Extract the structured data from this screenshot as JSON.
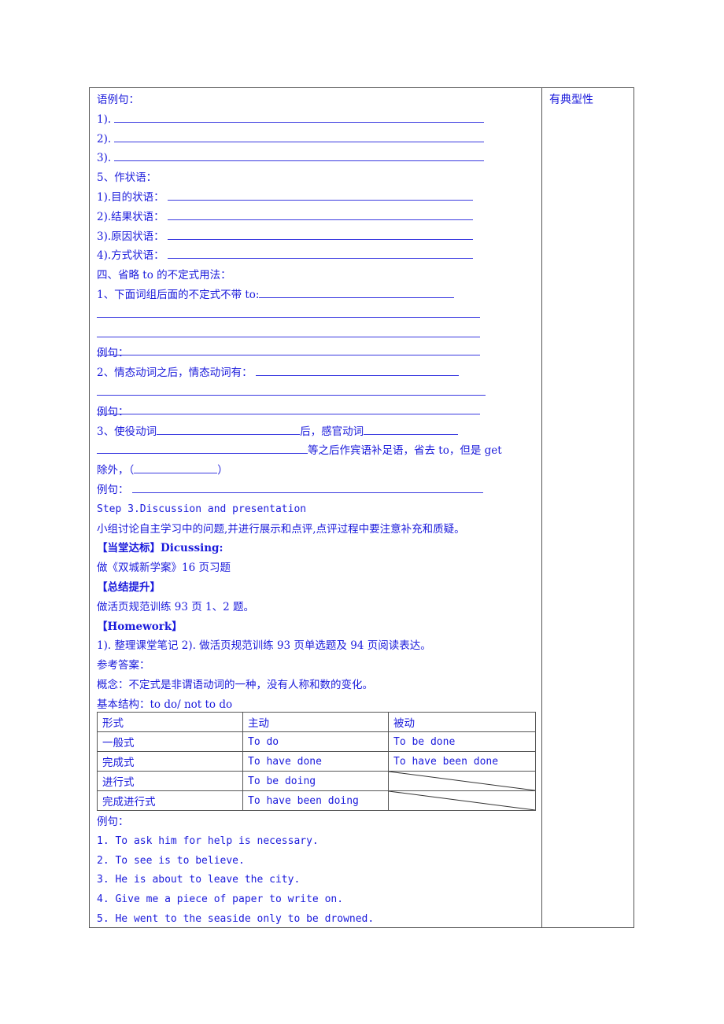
{
  "side_note": "有典型性",
  "lines": {
    "l0": "语例句：",
    "l1": "1).",
    "l2": "2).",
    "l3": "3).",
    "l4": "5、作状语：",
    "l5": "1).目的状语：",
    "l6": "2).结果状语：",
    "l7": "3).原因状语：",
    "l8": "4).方式状语：",
    "l9": "四、省略 to 的不定式用法：",
    "l10": "1、下面词组后面的不定式不带 to:",
    "l13": "例句：",
    "l14": "2、情态动词之后，情态动词有：",
    "l16": "例句：",
    "l17a": "3、使役动词",
    "l17b": "后，感官动词",
    "l18": "等之后作宾语补足语，省去 to，但是 get",
    "l19a": "除外，（",
    "l19b": "）",
    "l20": "例句：",
    "l21": "Step 3.Discussion and presentation",
    "l22": "小组讨论自主学习中的问题,并进行展示和点评,点评过程中要注意补充和质疑。",
    "l23": "【当堂达标】Dicussing:",
    "l24": "做《双城新学案》16 页习题",
    "l25": "【总结提升】",
    "l26": "做活页规范训练 93 页 1、2 题。",
    "l27": "【Homework】",
    "l28": "1). 整理课堂笔记 2). 做活页规范训练 93 页单选题及 94 页阅读表达。",
    "l29": "参考答案：",
    "l30": "概念：不定式是非谓语动词的一种，没有人称和数的变化。",
    "l31": "基本结构：to do/ not to do"
  },
  "table": {
    "headers": [
      "形式",
      "主动",
      "被动"
    ],
    "rows": [
      [
        "一般式",
        "To do",
        "To be done"
      ],
      [
        "完成式",
        "To have done",
        "To have been done"
      ],
      [
        "进行式",
        "To be doing",
        ""
      ],
      [
        "完成进行式",
        "To have been doing",
        ""
      ]
    ]
  },
  "examples_label": "例句：",
  "examples": [
    "1.  To ask him for help is necessary.",
    "2.  To see is to believe.",
    "3.  He is about to leave the city.",
    "4.  Give me a piece of paper to write on.",
    "5.  He went to the seaside only to be drowned."
  ]
}
